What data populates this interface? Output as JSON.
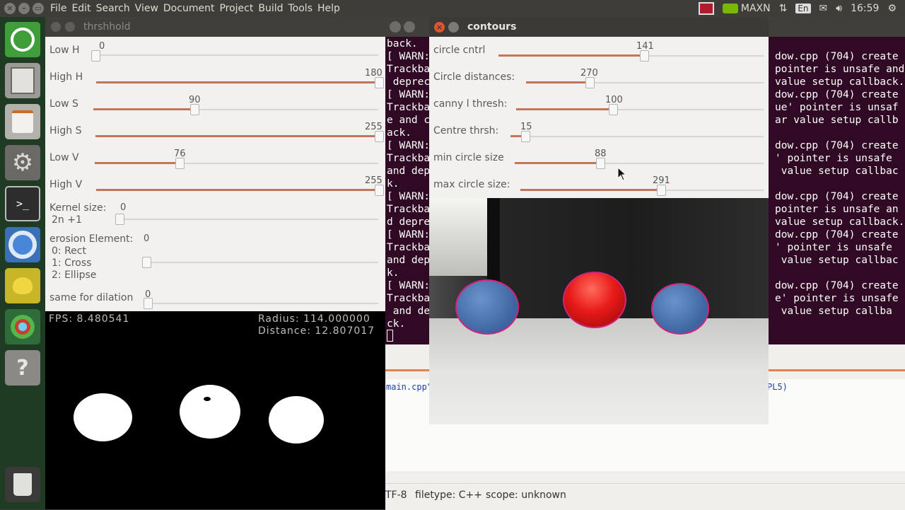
{
  "menu": [
    "File",
    "Edit",
    "Search",
    "View",
    "Document",
    "Project",
    "Build",
    "Tools",
    "Help"
  ],
  "tray": {
    "nvidia_label": "MAXN",
    "keyboard": "En",
    "time": "16:59"
  },
  "launcher": [
    "ubuntu-logo-icon",
    "file-cabinet-icon",
    "shopping-bag-icon",
    "settings-wrench-icon",
    "terminal-icon",
    "chromium-icon",
    "teapot-icon",
    "camera-icon",
    "help-icon",
    "trash-icon"
  ],
  "thrshhold": {
    "title": "thrshhold",
    "sliders": [
      {
        "label": "Low H",
        "value": "0"
      },
      {
        "label": "High H",
        "value": "180"
      },
      {
        "label": "Low S",
        "value": "90"
      },
      {
        "label": "High S",
        "value": "255"
      },
      {
        "label": "Low V",
        "value": "76"
      },
      {
        "label": "High V",
        "value": "255"
      },
      {
        "label": "Kernel size:",
        "sublabel": "2n +1",
        "value": "0"
      },
      {
        "label": "erosion Element:",
        "options": [
          "0: Rect",
          "1: Cross",
          "2: Ellipse"
        ],
        "value": "0"
      },
      {
        "label": "same for dilation",
        "value": "0"
      }
    ]
  },
  "binary": {
    "fps": "FPS: 8.480541",
    "radius": "Radius: 114.000000",
    "distance": "Distance: 12.807017"
  },
  "contours": {
    "title": "contours",
    "sliders": [
      {
        "label": "circle cntrl",
        "value": "141"
      },
      {
        "label": "Circle distances:",
        "value": "270"
      },
      {
        "label": "canny l thresh:",
        "value": "100"
      },
      {
        "label": "Centre thrsh:",
        "value": "15"
      },
      {
        "label": "min circle size",
        "value": "88"
      },
      {
        "label": "max circle size:",
        "value": "291"
      }
    ]
  },
  "terminal": {
    "left": [
      "back.",
      "[ WARN:",
      "Trackba",
      " depreca",
      "[ WARN:",
      "Trackba",
      "e and c",
      "ack.",
      "[ WARN:",
      "Trackba",
      "and dep",
      "k.",
      "[ WARN:",
      "Trackba",
      "d depre",
      "[ WARN:",
      "Trackba",
      "and dep",
      "k.",
      "[ WARN:",
      "Trackba",
      " and de",
      "ck."
    ],
    "right": [
      "dow.cpp (704) create",
      "pointer is unsafe and",
      "value setup callback.",
      "dow.cpp (704) create",
      "ue' pointer is unsaf",
      "ar value setup callb",
      "",
      "dow.cpp (704) create",
      "' pointer is unsafe",
      " value setup callbac",
      "",
      "dow.cpp (704) create",
      "pointer is unsafe an",
      "value setup callback.",
      "dow.cpp (704) create",
      "' pointer is unsafe",
      " value setup callbac",
      "",
      "dow.cpp (704) create",
      "e' pointer is unsafe",
      " value setup callba"
    ]
  },
  "editor": {
    "file_msg": "main.cpp\"",
    "right_msg": "PL5)",
    "status_encoding": "TF-8",
    "status_filetype": "filetype: C++",
    "status_scope": "scope: unknown"
  }
}
